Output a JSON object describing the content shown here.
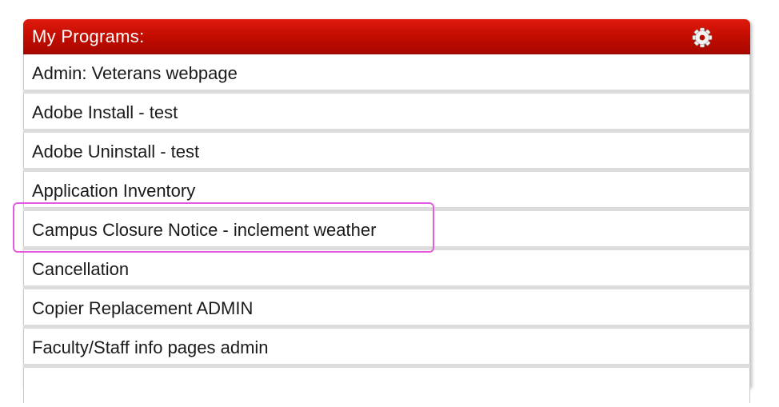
{
  "panel": {
    "title": "My Programs:",
    "settings_icon": "gear-icon",
    "header_color": "#c20d00",
    "highlight_color": "#e55be0"
  },
  "programs": [
    {
      "label": "Admin: Veterans webpage"
    },
    {
      "label": "Adobe Install - test"
    },
    {
      "label": "Adobe Uninstall - test"
    },
    {
      "label": "Application Inventory"
    },
    {
      "label": "Campus Closure Notice - inclement weather"
    },
    {
      "label": "Cancellation"
    },
    {
      "label": "Copier Replacement ADMIN"
    },
    {
      "label": "Faculty/Staff info pages admin"
    },
    {
      "label": ""
    }
  ]
}
